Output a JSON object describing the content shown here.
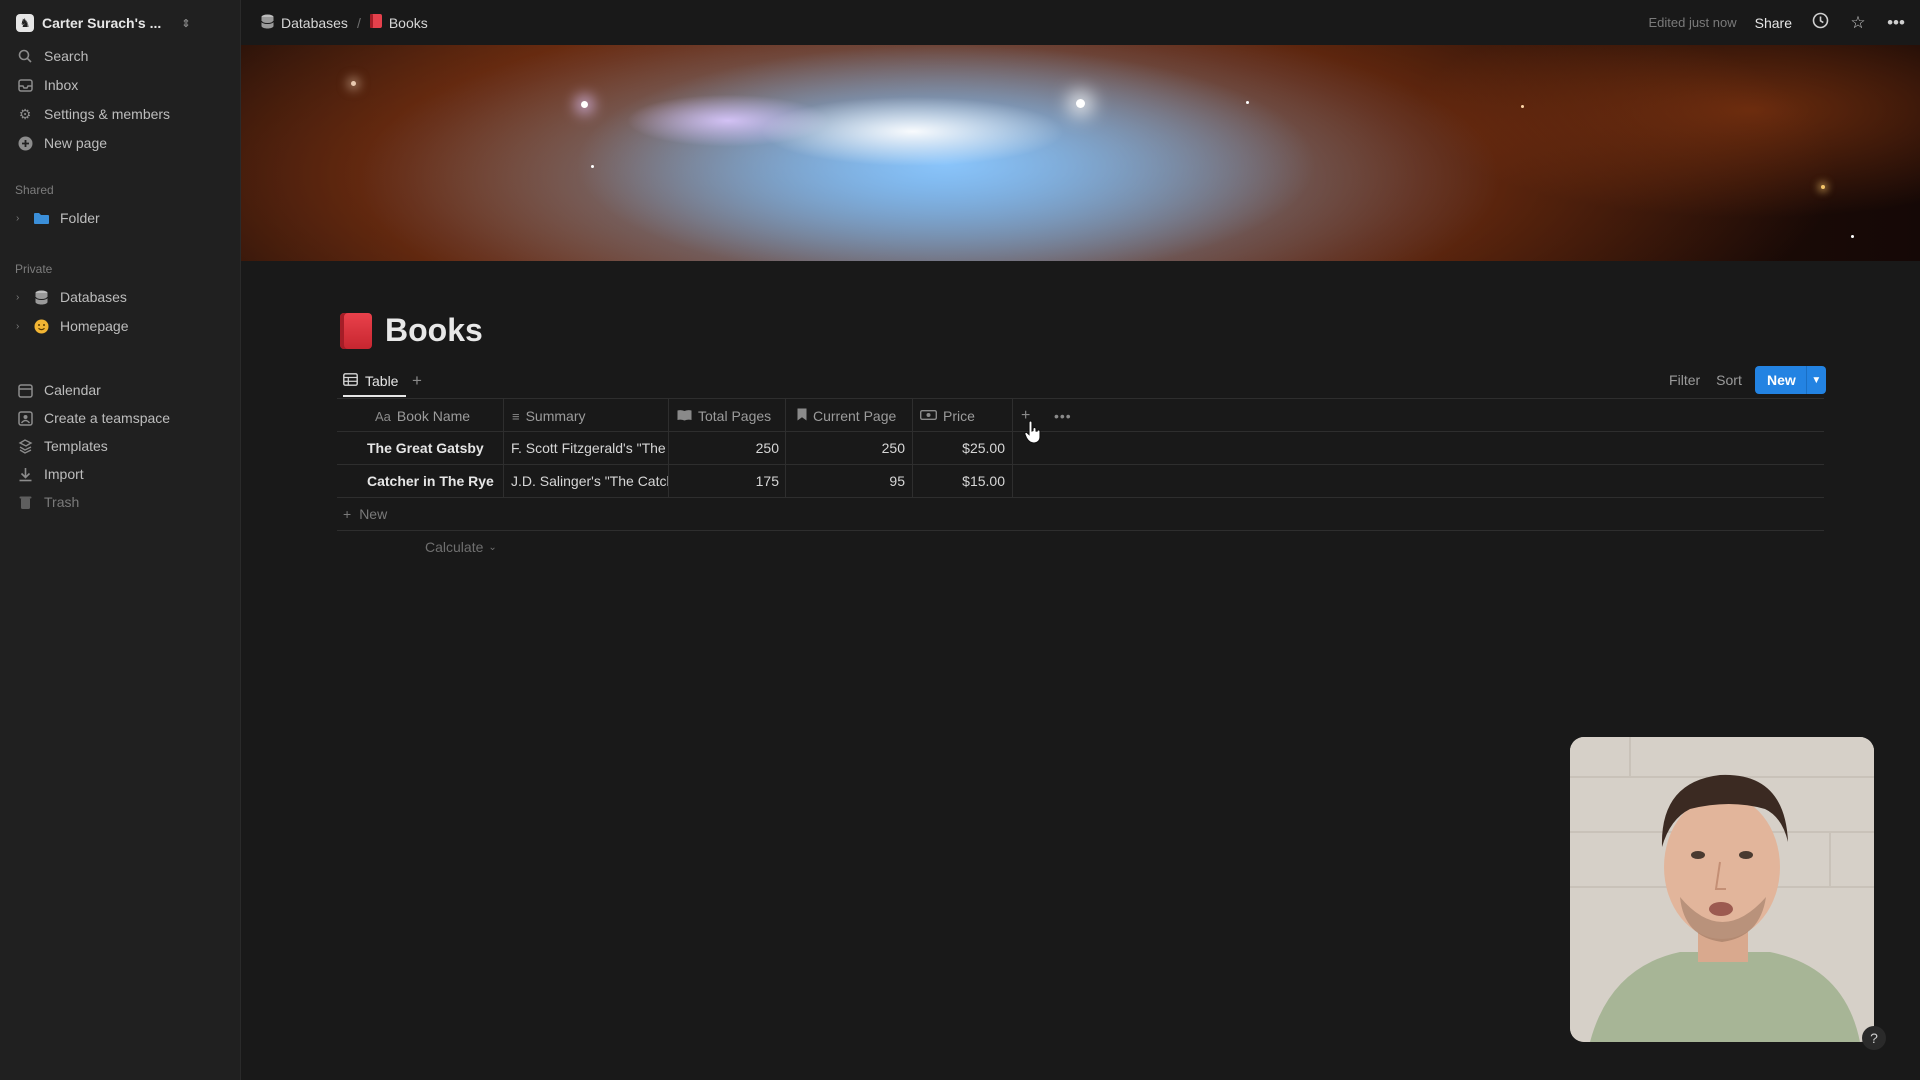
{
  "workspace": {
    "name": "Carter Surach's ...",
    "avatar_glyph": "♞"
  },
  "sidebar": {
    "top_items": [
      {
        "label": "Search",
        "icon": "search-icon"
      },
      {
        "label": "Inbox",
        "icon": "inbox-icon"
      },
      {
        "label": "Settings & members",
        "icon": "gear-icon"
      },
      {
        "label": "New page",
        "icon": "plus-circle-icon"
      }
    ],
    "shared_label": "Shared",
    "shared_items": [
      {
        "label": "Folder",
        "icon": "folder-icon"
      }
    ],
    "private_label": "Private",
    "private_items": [
      {
        "label": "Databases",
        "icon": "database-icon"
      },
      {
        "label": "Homepage",
        "icon": "smiley-icon"
      }
    ],
    "bottom_items": [
      {
        "label": "Calendar",
        "icon": "calendar-icon"
      },
      {
        "label": "Create a teamspace",
        "icon": "teamspace-icon"
      },
      {
        "label": "Templates",
        "icon": "templates-icon"
      },
      {
        "label": "Import",
        "icon": "import-icon"
      },
      {
        "label": "Trash",
        "icon": "trash-icon"
      }
    ]
  },
  "topbar": {
    "breadcrumb": [
      {
        "label": "Databases",
        "icon": "database-icon"
      },
      {
        "label": "Books",
        "icon": "book-icon"
      }
    ],
    "separator": "/",
    "edited": "Edited just now",
    "share": "Share"
  },
  "page": {
    "title": "Books",
    "icon": "red-book-icon"
  },
  "views": {
    "active": "Table",
    "add": "+"
  },
  "toolbar": {
    "filter": "Filter",
    "sort": "Sort",
    "new": "New"
  },
  "table": {
    "columns": [
      {
        "label": "Book Name",
        "prefix": "Aa"
      },
      {
        "label": "Summary",
        "icon": "text-lines-icon"
      },
      {
        "label": "Total Pages",
        "icon": "open-book-icon"
      },
      {
        "label": "Current Page",
        "icon": "bookmark-icon"
      },
      {
        "label": "Price",
        "icon": "money-icon"
      }
    ],
    "rows": [
      {
        "name": "The Great Gatsby",
        "summary": "F. Scott Fitzgerald's \"The Great Gatsby\"",
        "total": "250",
        "current": "250",
        "price": "$25.00"
      },
      {
        "name": "Catcher in The Rye",
        "summary": "J.D. Salinger's \"The Catcher in the Rye\"",
        "total": "175",
        "current": "95",
        "price": "$15.00"
      }
    ],
    "new_row": "New",
    "calculate": "Calculate"
  },
  "colors": {
    "accent": "#2383e2",
    "background": "#191919",
    "sidebar": "#202020"
  }
}
